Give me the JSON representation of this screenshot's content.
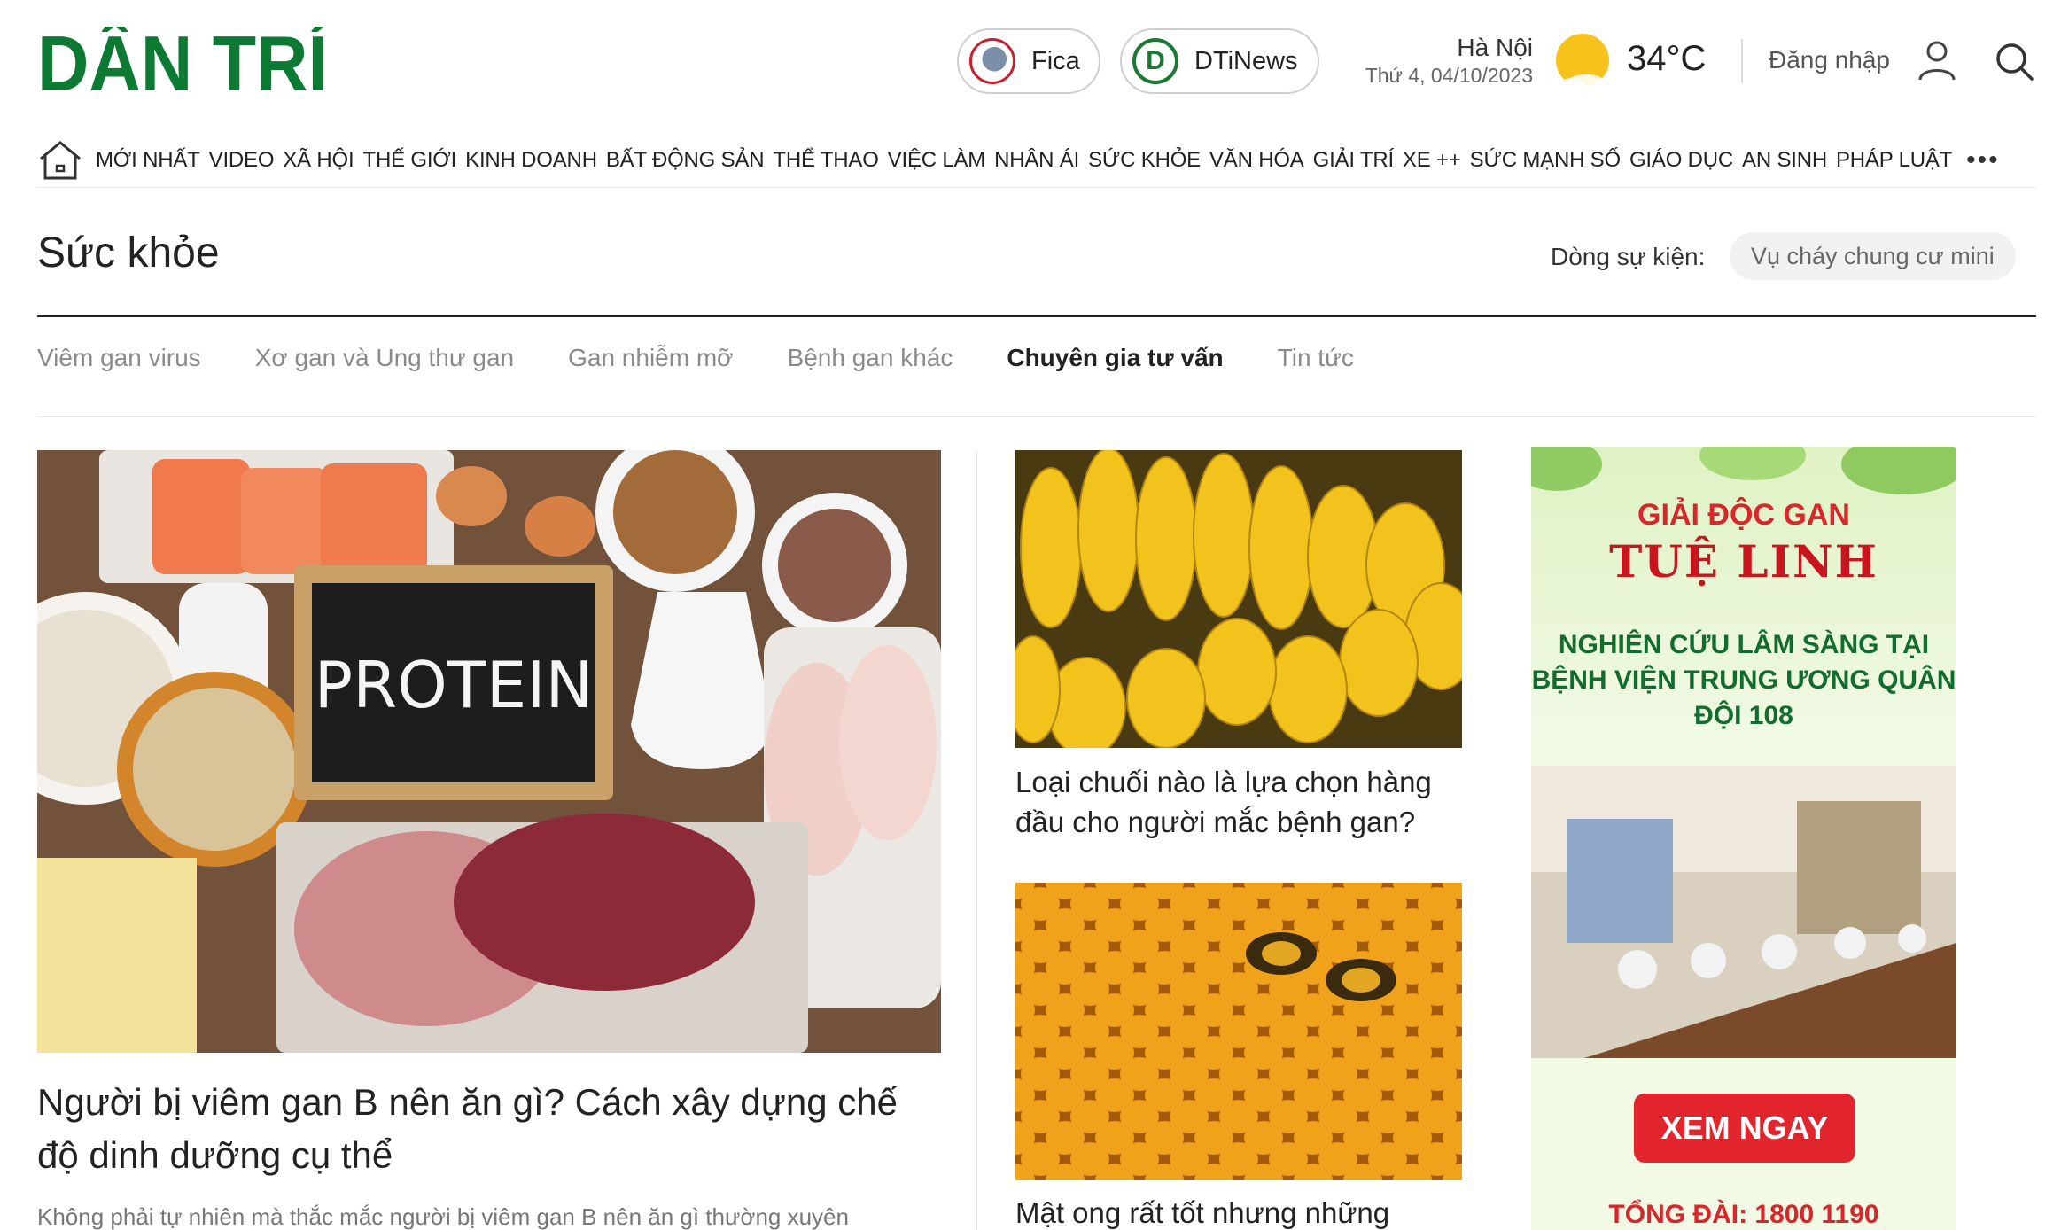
{
  "brand": {
    "logo_text": "DÂN TRÍ",
    "logo_color": "#0d7a33"
  },
  "header": {
    "links": [
      {
        "label": "Fica",
        "icon": "fica-globe-icon"
      },
      {
        "label": "DTiNews",
        "icon": "dtinews-logo-icon"
      }
    ],
    "weather": {
      "city": "Hà Nội",
      "date": "Thứ 4, 04/10/2023",
      "temperature": "34°C",
      "icon": "sun-cloud-icon"
    },
    "login_label": "Đăng nhập"
  },
  "nav": {
    "items": [
      "MỚI NHẤT",
      "VIDEO",
      "XÃ HỘI",
      "THẾ GIỚI",
      "KINH DOANH",
      "BẤT ĐỘNG SẢN",
      "THỂ THAO",
      "VIỆC LÀM",
      "NHÂN ÁI",
      "SỨC KHỎE",
      "VĂN HÓA",
      "GIẢI TRÍ",
      "XE ++",
      "SỨC MẠNH SỐ",
      "GIÁO DỤC",
      "AN SINH",
      "PHÁP LUẬT"
    ],
    "more_label": "•••"
  },
  "section": {
    "title": "Sức khỏe",
    "event_label": "Dòng sự kiện:",
    "event_value": "Vụ cháy chung cư mini",
    "subnav": [
      "Viêm gan virus",
      "Xơ gan và Ung thư gan",
      "Gan nhiễm mỡ",
      "Bệnh gan khác",
      "Chuyên gia tư vấn",
      "Tin tức"
    ],
    "active_subnav": "Chuyên gia tư vấn"
  },
  "articles": {
    "main": {
      "image_text": "PROTEIN",
      "title": "Người bị viêm gan B nên ăn gì? Cách xây dựng chế độ dinh dưỡng cụ thể",
      "sapo": "Không phải tự nhiên mà thắc mắc người bị viêm gan B nên ăn gì thường xuyên"
    },
    "side": [
      {
        "title": "Loại chuối nào là lựa chọn hàng đầu cho người mắc bệnh gan?"
      },
      {
        "title": "Mật ong rất tốt nhưng những"
      }
    ]
  },
  "ad": {
    "line1": "GIẢI ĐỘC GAN",
    "line2": "TUỆ LINH",
    "line3": "NGHIÊN CỨU LÂM SÀNG TẠI BỆNH VIỆN TRUNG ƯƠNG QUÂN ĐỘI 108",
    "button": "XEM NGAY",
    "hotline": "TỔNG ĐÀI: 1800 1190"
  }
}
